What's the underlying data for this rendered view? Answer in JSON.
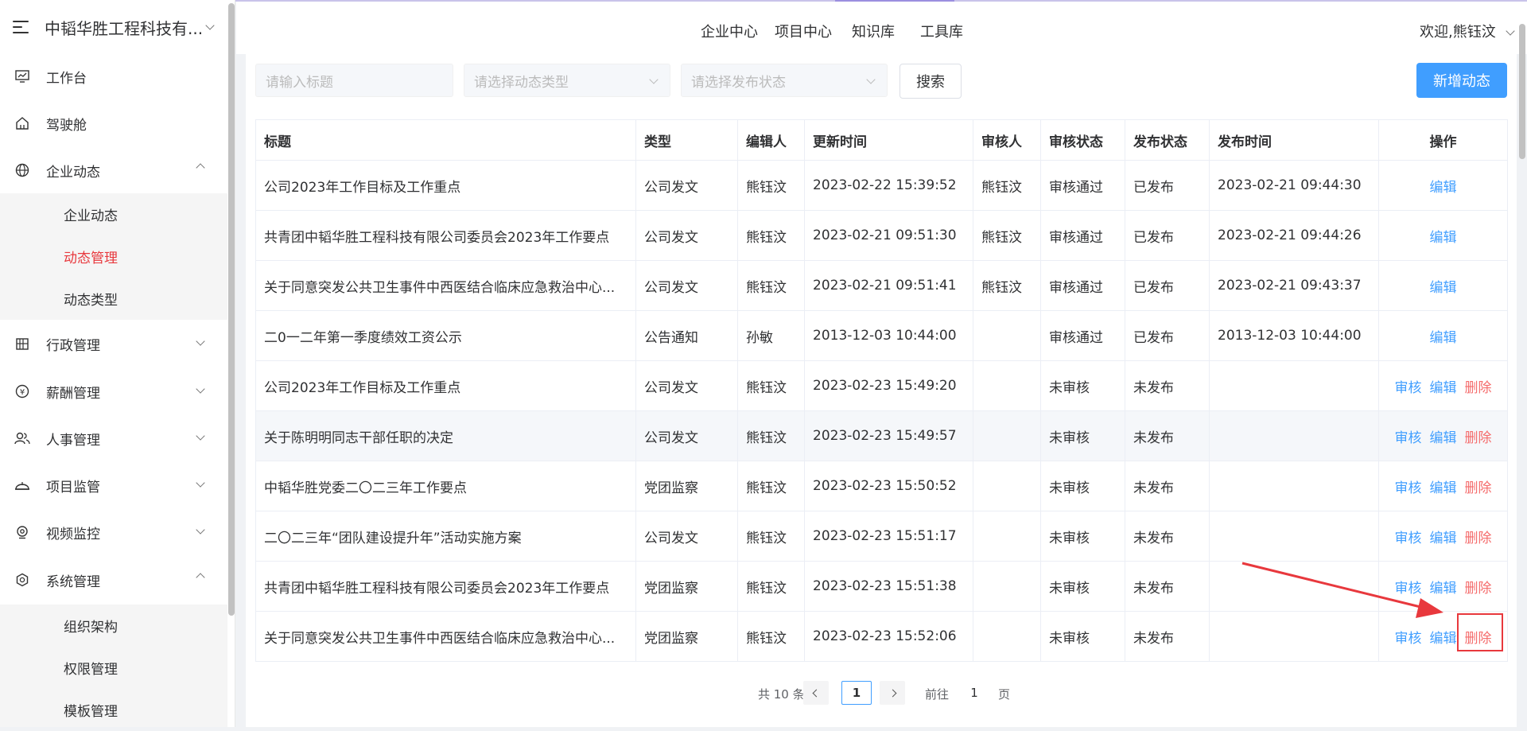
{
  "sidebar": {
    "brand_title": "中韬华胜工程科技有...",
    "items": [
      {
        "label": "工作台"
      },
      {
        "label": "驾驶舱"
      },
      {
        "label": "企业动态"
      },
      {
        "label": "行政管理"
      },
      {
        "label": "薪酬管理"
      },
      {
        "label": "人事管理"
      },
      {
        "label": "项目监管"
      },
      {
        "label": "视频监控"
      },
      {
        "label": "系统管理"
      }
    ],
    "enterprise_sub": [
      "企业动态",
      "动态管理",
      "动态类型"
    ],
    "system_sub": [
      "组织架构",
      "权限管理",
      "模板管理"
    ]
  },
  "header": {
    "tabs": [
      "企业中心",
      "项目中心",
      "知识库",
      "工具库"
    ],
    "welcome": "欢迎,熊钰汶"
  },
  "filters": {
    "title_placeholder": "请输入标题",
    "type_placeholder": "请选择动态类型",
    "status_placeholder": "请选择发布状态",
    "search_label": "搜索",
    "add_label": "新增动态"
  },
  "table": {
    "columns": [
      "标题",
      "类型",
      "编辑人",
      "更新时间",
      "审核人",
      "审核状态",
      "发布状态",
      "发布时间",
      "操作"
    ],
    "rows": [
      {
        "title": "公司2023年工作目标及工作重点",
        "type": "公司发文",
        "editor": "熊钰汶",
        "updated": "2023-02-22 15:39:52",
        "reviewer": "熊钰汶",
        "review_status": "审核通过",
        "publish_status": "已发布",
        "publish_time": "2023-02-21 09:44:30"
      },
      {
        "title": "共青团中韬华胜工程科技有限公司委员会2023年工作要点",
        "type": "公司发文",
        "editor": "熊钰汶",
        "updated": "2023-02-21 09:51:30",
        "reviewer": "熊钰汶",
        "review_status": "审核通过",
        "publish_status": "已发布",
        "publish_time": "2023-02-21 09:44:26"
      },
      {
        "title": "关于同意突发公共卫生事件中西医结合临床应急救治中心...",
        "type": "公司发文",
        "editor": "熊钰汶",
        "updated": "2023-02-21 09:51:41",
        "reviewer": "熊钰汶",
        "review_status": "审核通过",
        "publish_status": "已发布",
        "publish_time": "2023-02-21 09:43:37"
      },
      {
        "title": "二0一二年第一季度绩效工资公示",
        "type": "公告通知",
        "editor": "孙敏",
        "updated": "2013-12-03 10:44:00",
        "reviewer": "",
        "review_status": "审核通过",
        "publish_status": "已发布",
        "publish_time": "2013-12-03 10:44:00"
      },
      {
        "title": "公司2023年工作目标及工作重点",
        "type": "公司发文",
        "editor": "熊钰汶",
        "updated": "2023-02-23 15:49:20",
        "reviewer": "",
        "review_status": "未审核",
        "publish_status": "未发布",
        "publish_time": ""
      },
      {
        "title": "关于陈明明同志干部任职的决定",
        "type": "公司发文",
        "editor": "熊钰汶",
        "updated": "2023-02-23 15:49:57",
        "reviewer": "",
        "review_status": "未审核",
        "publish_status": "未发布",
        "publish_time": ""
      },
      {
        "title": "中韬华胜党委二〇二三年工作要点",
        "type": "党团监察",
        "editor": "熊钰汶",
        "updated": "2023-02-23 15:50:52",
        "reviewer": "",
        "review_status": "未审核",
        "publish_status": "未发布",
        "publish_time": ""
      },
      {
        "title": "二〇二三年“团队建设提升年”活动实施方案",
        "type": "公司发文",
        "editor": "熊钰汶",
        "updated": "2023-02-23 15:51:17",
        "reviewer": "",
        "review_status": "未审核",
        "publish_status": "未发布",
        "publish_time": ""
      },
      {
        "title": "共青团中韬华胜工程科技有限公司委员会2023年工作要点",
        "type": "党团监察",
        "editor": "熊钰汶",
        "updated": "2023-02-23 15:51:38",
        "reviewer": "",
        "review_status": "未审核",
        "publish_status": "未发布",
        "publish_time": ""
      },
      {
        "title": "关于同意突发公共卫生事件中西医结合临床应急救治中心...",
        "type": "党团监察",
        "editor": "熊钰汶",
        "updated": "2023-02-23 15:52:06",
        "reviewer": "",
        "review_status": "未审核",
        "publish_status": "未发布",
        "publish_time": ""
      }
    ],
    "op_review": "审核",
    "op_edit": "编辑",
    "op_delete": "删除"
  },
  "pagination": {
    "total_text": "共 10 条",
    "current_page": "1",
    "goto_prefix": "前往",
    "goto_value": "1",
    "goto_suffix": "页"
  },
  "colors": {
    "accent_red": "#e8383d",
    "primary_blue": "#409eff",
    "danger_red": "#f56c6c"
  }
}
